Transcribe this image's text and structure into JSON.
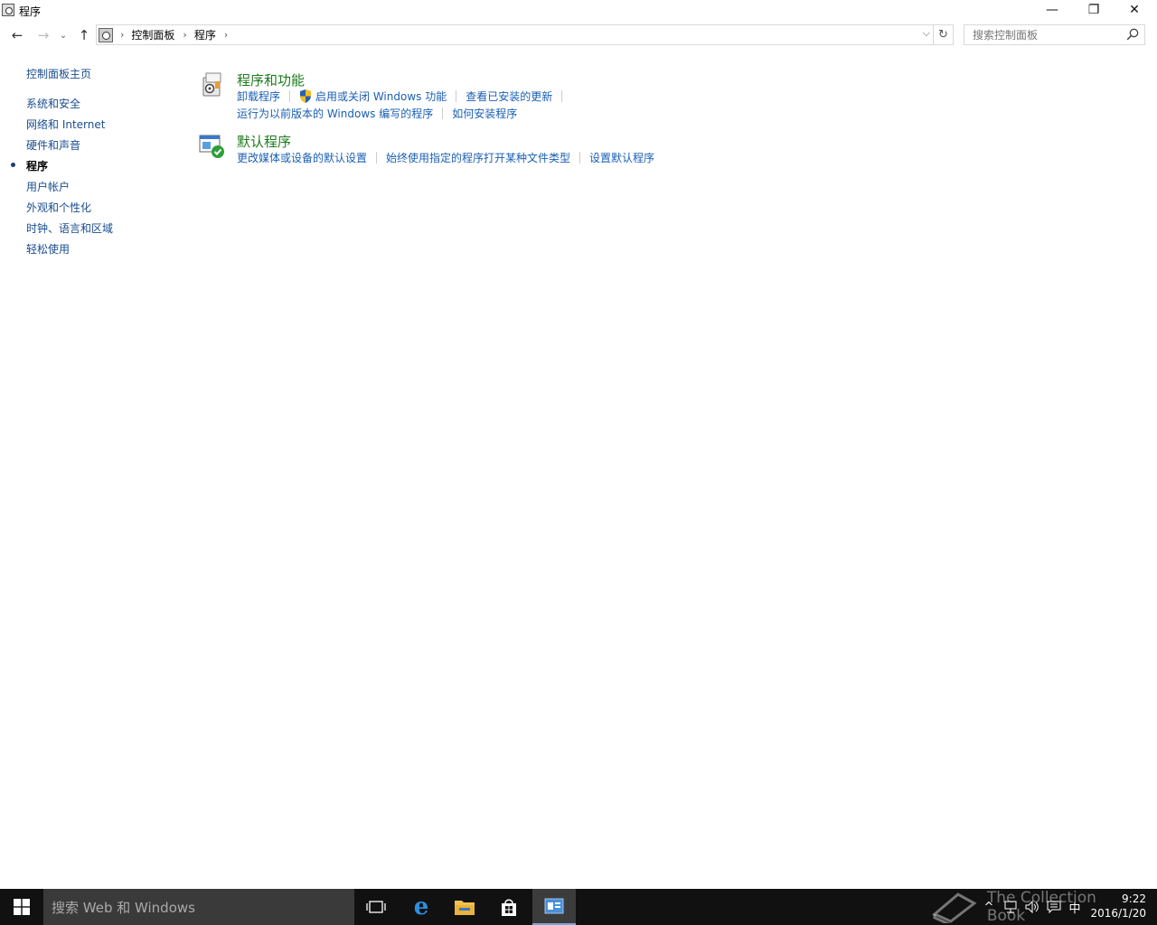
{
  "window": {
    "title": "程序",
    "controls": {
      "minimize": "—",
      "maximize": "❐",
      "close": "✕"
    }
  },
  "nav": {
    "back": "←",
    "forward": "→",
    "recent": "⌄",
    "up": "↑",
    "breadcrumb": [
      "控制面板",
      "程序"
    ],
    "refresh": "↻",
    "search_placeholder": "搜索控制面板"
  },
  "sidebar": {
    "home": "控制面板主页",
    "items": [
      {
        "label": "系统和安全",
        "active": false
      },
      {
        "label": "网络和 Internet",
        "active": false
      },
      {
        "label": "硬件和声音",
        "active": false
      },
      {
        "label": "程序",
        "active": true
      },
      {
        "label": "用户帐户",
        "active": false
      },
      {
        "label": "外观和个性化",
        "active": false
      },
      {
        "label": "时钟、语言和区域",
        "active": false
      },
      {
        "label": "轻松使用",
        "active": false
      }
    ]
  },
  "sections": [
    {
      "title": "程序和功能",
      "icon": "programs-features-icon",
      "rows": [
        [
          "卸载程序",
          "启用或关闭 Windows 功能",
          "查看已安装的更新"
        ],
        [
          "运行为以前版本的 Windows 编写的程序",
          "如何安装程序"
        ]
      ]
    },
    {
      "title": "默认程序",
      "icon": "default-programs-icon",
      "rows": [
        [
          "更改媒体或设备的默认设置",
          "始终使用指定的程序打开某种文件类型",
          "设置默认程序"
        ]
      ]
    }
  ],
  "taskbar": {
    "search_text": "搜索 Web 和 Windows",
    "time": "9:22",
    "date": "2016/1/20",
    "ime": "中",
    "watermark": "The Collection Book"
  }
}
